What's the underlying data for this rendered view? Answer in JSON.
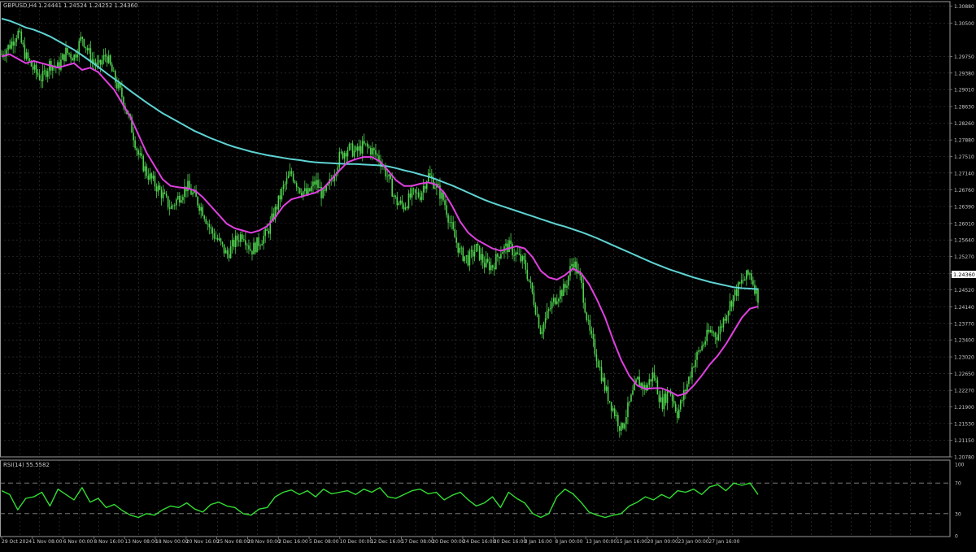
{
  "header": {
    "symbol_timeframe": "GBPUSD,H4",
    "ohlc": "1.24441 1.24524 1.24252 1.24360"
  },
  "indicator": {
    "label": "RSI(14) 55.5582"
  },
  "current_price": "1.24360",
  "colors": {
    "background": "#000000",
    "grid": "#3a3a3a",
    "axis_text": "#c8c8c8",
    "candle": "#4fd34f",
    "ma_fast": "#e040e0",
    "ma_slow": "#5fd3d3",
    "rsi": "#33dd33",
    "price_tag_bg": "#ffffff",
    "price_tag_text": "#000000"
  },
  "chart_data": [
    {
      "type": "line",
      "title": "GBPUSD,H4",
      "ylim": [
        1.2078,
        1.3098
      ],
      "y_ticks": [
        "1.30880",
        "1.30500",
        "1.29750",
        "1.29380",
        "1.29010",
        "1.28630",
        "1.28260",
        "1.27880",
        "1.27510",
        "1.27140",
        "1.26760",
        "1.26390",
        "1.26010",
        "1.25640",
        "1.25270",
        "1.24890",
        "1.24520",
        "1.24140",
        "1.23770",
        "1.23400",
        "1.23020",
        "1.22650",
        "1.22270",
        "1.21900",
        "1.21530",
        "1.21150",
        "1.20780"
      ],
      "x_ticks": [
        "29 Oct 2024",
        "1 Nov 08:00",
        "6 Nov 00:00",
        "8 Nov 16:00",
        "13 Nov 08:00",
        "18 Nov 00:00",
        "20 Nov 16:00",
        "25 Nov 08:00",
        "28 Nov 00:00",
        "2 Dec 16:00",
        "5 Dec 08:00",
        "10 Dec 00:00",
        "12 Dec 16:00",
        "17 Dec 08:00",
        "20 Dec 00:00",
        "24 Dec 16:00",
        "30 Dec 16:00",
        "3 Jan 16:00",
        "8 Jan 00:00",
        "13 Jan 00:00",
        "15 Jan 16:00",
        "20 Jan 00:00",
        "23 Jan 00:00",
        "27 Jan 16:00"
      ],
      "series": [
        {
          "kind": "price",
          "values": [
            1.298,
            1.3,
            1.303,
            1.2975,
            1.2945,
            1.2925,
            1.296,
            1.295,
            1.2985,
            1.2975,
            1.302,
            1.2975,
            1.295,
            1.298,
            1.2925,
            1.2885,
            1.2825,
            1.2755,
            1.2715,
            1.269,
            1.2665,
            1.2635,
            1.266,
            1.2685,
            1.266,
            1.263,
            1.2585,
            1.256,
            1.253,
            1.256,
            1.258,
            1.254,
            1.256,
            1.258,
            1.263,
            1.268,
            1.2715,
            1.268,
            1.2665,
            1.2695,
            1.266,
            1.27,
            1.275,
            1.277,
            1.276,
            1.2775,
            1.2765,
            1.2745,
            1.2705,
            1.265,
            1.264,
            1.2665,
            1.2665,
            1.271,
            1.2685,
            1.265,
            1.2585,
            1.2535,
            1.252,
            1.2545,
            1.251,
            1.2505,
            1.254,
            1.255,
            1.253,
            1.251,
            1.244,
            1.236,
            1.2405,
            1.244,
            1.2455,
            1.252,
            1.247,
            1.236,
            1.23,
            1.223,
            1.2185,
            1.214,
            1.2195,
            1.225,
            1.223,
            1.2265,
            1.2195,
            1.223,
            1.2175,
            1.223,
            1.229,
            1.2325,
            1.236,
            1.235,
            1.24,
            1.244,
            1.247,
            1.249,
            1.2436
          ]
        },
        {
          "kind": "ma_fast",
          "values": [
            1.2975,
            1.298,
            1.297,
            1.296,
            1.2965,
            1.296,
            1.2955,
            1.295,
            1.2955,
            1.296,
            1.2945,
            1.295,
            1.294,
            1.292,
            1.29,
            1.287,
            1.284,
            1.28,
            1.276,
            1.273,
            1.27,
            1.2685,
            1.2682,
            1.268,
            1.2675,
            1.266,
            1.264,
            1.262,
            1.26,
            1.259,
            1.2585,
            1.258,
            1.2585,
            1.2595,
            1.2615,
            1.264,
            1.2655,
            1.266,
            1.2665,
            1.267,
            1.268,
            1.27,
            1.272,
            1.2738,
            1.2745,
            1.275,
            1.275,
            1.274,
            1.272,
            1.2698,
            1.2685,
            1.2685,
            1.269,
            1.2693,
            1.2688,
            1.267,
            1.264,
            1.2605,
            1.258,
            1.2565,
            1.2555,
            1.2545,
            1.254,
            1.2545,
            1.255,
            1.2545,
            1.2525,
            1.2495,
            1.248,
            1.2475,
            1.2485,
            1.25,
            1.249,
            1.2465,
            1.243,
            1.239,
            1.234,
            1.2295,
            1.226,
            1.2238,
            1.223,
            1.2232,
            1.2232,
            1.2225,
            1.2215,
            1.222,
            1.2238,
            1.226,
            1.2285,
            1.2305,
            1.233,
            1.236,
            1.239,
            1.241,
            1.2415
          ]
        },
        {
          "kind": "ma_slow",
          "values": [
            1.306,
            1.3055,
            1.3048,
            1.304,
            1.3035,
            1.3028,
            1.302,
            1.301,
            1.3,
            1.299,
            1.2978,
            1.2965,
            1.2952,
            1.2938,
            1.2925,
            1.2912,
            1.2898,
            1.2885,
            1.2872,
            1.286,
            1.2848,
            1.2838,
            1.2828,
            1.2818,
            1.2808,
            1.28,
            1.2792,
            1.2785,
            1.2778,
            1.2772,
            1.2767,
            1.2762,
            1.2758,
            1.2754,
            1.2751,
            1.2748,
            1.2745,
            1.2743,
            1.274,
            1.2738,
            1.2737,
            1.2736,
            1.2735,
            1.2734,
            1.2734,
            1.2733,
            1.2732,
            1.2731,
            1.2729,
            1.2725,
            1.272,
            1.2716,
            1.2711,
            1.2706,
            1.27,
            1.2693,
            1.2686,
            1.2678,
            1.267,
            1.2662,
            1.2654,
            1.2647,
            1.2641,
            1.2635,
            1.2629,
            1.2623,
            1.2617,
            1.2611,
            1.2605,
            1.2599,
            1.2594,
            1.2588,
            1.2582,
            1.2575,
            1.2568,
            1.256,
            1.2552,
            1.2544,
            1.2536,
            1.2528,
            1.252,
            1.2512,
            1.2505,
            1.2498,
            1.2492,
            1.2486,
            1.248,
            1.2475,
            1.247,
            1.2466,
            1.2462,
            1.2458,
            1.2456,
            1.2455,
            1.2454
          ]
        }
      ]
    },
    {
      "type": "line",
      "title": "RSI(14) 55.5582",
      "ylim": [
        0,
        100
      ],
      "y_ticks": [
        "100",
        "70",
        "30",
        "0"
      ],
      "levels": [
        70,
        30
      ],
      "series": [
        {
          "kind": "rsi",
          "values": [
            60,
            55,
            35,
            50,
            52,
            58,
            40,
            62,
            55,
            48,
            64,
            45,
            50,
            38,
            42,
            34,
            28,
            25,
            30,
            28,
            35,
            40,
            38,
            44,
            36,
            32,
            42,
            45,
            40,
            38,
            30,
            28,
            36,
            38,
            52,
            58,
            61,
            55,
            60,
            52,
            62,
            56,
            58,
            60,
            55,
            62,
            58,
            64,
            52,
            50,
            55,
            60,
            62,
            56,
            58,
            48,
            54,
            58,
            48,
            40,
            44,
            52,
            38,
            58,
            50,
            44,
            30,
            25,
            30,
            52,
            62,
            56,
            45,
            32,
            28,
            25,
            28,
            30,
            40,
            45,
            52,
            48,
            55,
            50,
            60,
            58,
            62,
            55,
            65,
            68,
            60,
            70,
            67,
            70,
            55
          ]
        }
      ]
    }
  ]
}
